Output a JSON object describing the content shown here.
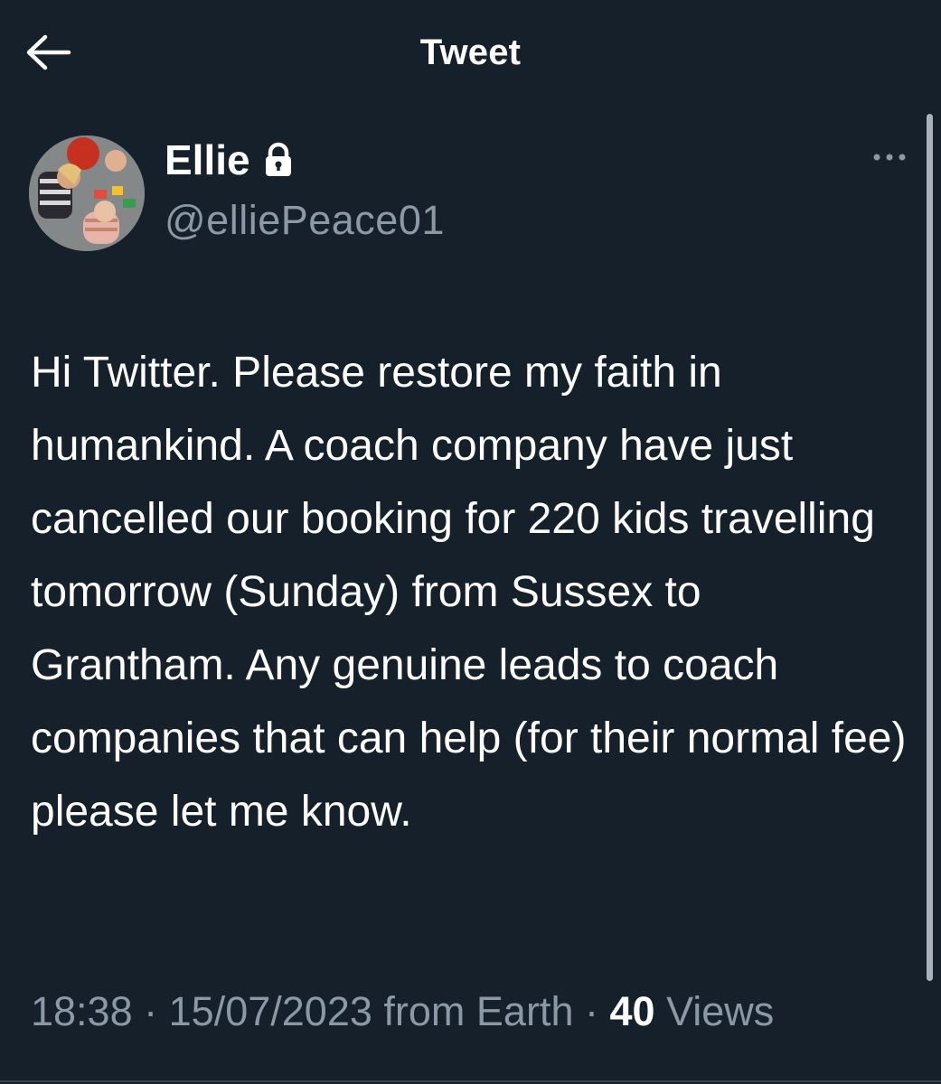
{
  "header": {
    "title": "Tweet",
    "back_icon": "arrow-left-icon"
  },
  "author": {
    "display_name": "Ellie",
    "handle": "@elliePeace01",
    "protected_icon": "lock-icon",
    "avatar_icon": "profile-photo"
  },
  "menu": {
    "more_icon": "more-horizontal-icon"
  },
  "tweet": {
    "text": "Hi Twitter. Please restore my faith in humankind. A coach company have just cancelled our booking for 220 kids travelling tomorrow (Sunday) from Sussex to Grantham. Any genuine leads to coach companies that can help (for their normal fee) please let me know."
  },
  "meta": {
    "time": "18:38",
    "separator": "·",
    "date": "15/07/2023",
    "source": "from Earth",
    "views_count": "40",
    "views_label": "Views"
  },
  "colors": {
    "background": "#15202b",
    "text": "#ffffff",
    "secondary_text": "#8b98a5",
    "divider": "#38444d"
  }
}
